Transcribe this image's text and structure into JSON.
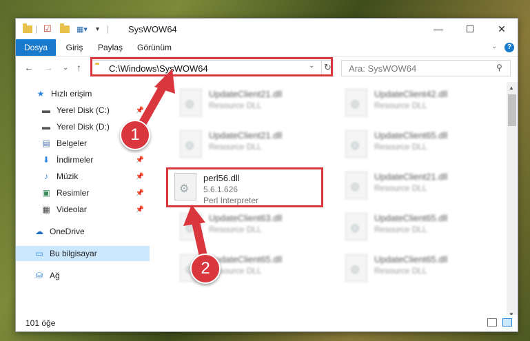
{
  "window": {
    "title": "SysWOW64",
    "controls": {
      "minimize": "—",
      "maximize": "☐",
      "close": "✕"
    }
  },
  "ribbon": {
    "tabs": [
      "Dosya",
      "Giriş",
      "Paylaş",
      "Görünüm"
    ]
  },
  "navigation": {
    "address": "C:\\Windows\\SysWOW64",
    "search_placeholder": "Ara: SysWOW64"
  },
  "sidebar": {
    "items": [
      {
        "label": "Hızlı erişim",
        "icon": "star-icon"
      },
      {
        "label": "Yerel Disk (C:)",
        "icon": "drive-icon",
        "pinned": true
      },
      {
        "label": "Yerel Disk (D:)",
        "icon": "drive-icon",
        "pinned": true
      },
      {
        "label": "Belgeler",
        "icon": "documents-icon",
        "pinned": true
      },
      {
        "label": "İndirmeler",
        "icon": "download-icon",
        "pinned": true
      },
      {
        "label": "Müzik",
        "icon": "music-icon",
        "pinned": true
      },
      {
        "label": "Resimler",
        "icon": "pictures-icon",
        "pinned": true
      },
      {
        "label": "Videolar",
        "icon": "video-icon",
        "pinned": true
      },
      {
        "label": "OneDrive",
        "icon": "cloud-icon"
      },
      {
        "label": "Bu bilgisayar",
        "icon": "computer-icon",
        "selected": true
      },
      {
        "label": "Ağ",
        "icon": "network-icon"
      }
    ]
  },
  "files": {
    "highlighted": {
      "name": "perl56.dll",
      "version": "5.6.1.626",
      "description": "Perl Interpreter"
    },
    "blurred": [
      {
        "name": "UpdateClient21.dll",
        "description": "Resource DLL"
      },
      {
        "name": "UpdateClient42.dll",
        "description": "Resource DLL"
      },
      {
        "name": "UpdateClient21.dll",
        "description": "Resource DLL"
      },
      {
        "name": "UpdateClient65.dll",
        "description": "Resource DLL"
      },
      {
        "name": "UpdateClient21.dll",
        "description": "Resource DLL"
      },
      {
        "name": "UpdateClient63.dll",
        "description": "Resource DLL"
      },
      {
        "name": "UpdateClient65.dll",
        "description": "Resource DLL"
      },
      {
        "name": "UpdateClient65.dll",
        "description": "Resource DLL"
      },
      {
        "name": "UpdateClient65.dll",
        "description": "Resource DLL"
      }
    ]
  },
  "status": {
    "item_count": "101 öğe"
  },
  "annotations": {
    "step1": "1",
    "step2": "2",
    "color": "#d9363e"
  }
}
